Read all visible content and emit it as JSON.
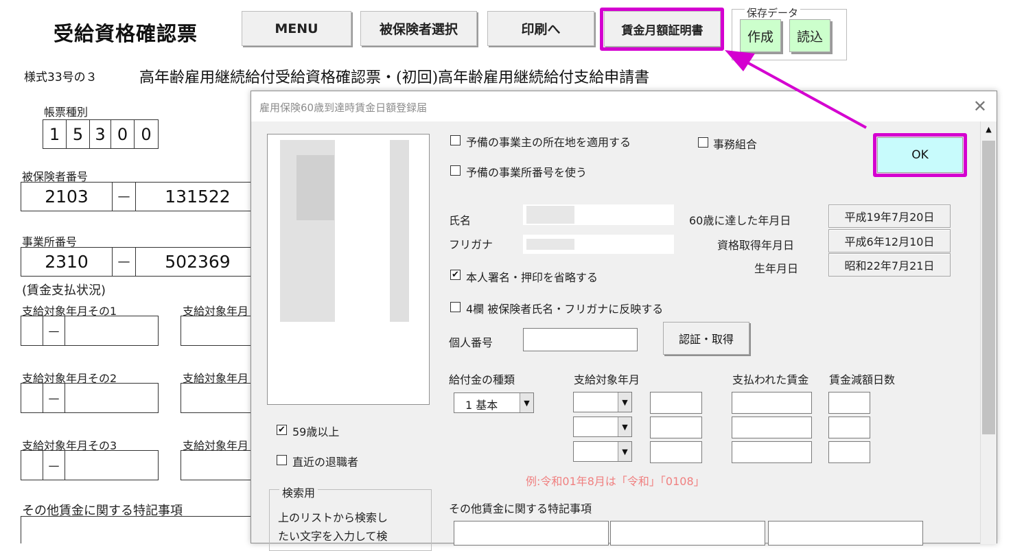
{
  "sheet": {
    "title": "受給資格確認票",
    "buttons": {
      "menu": "MENU",
      "insured_select": "被保険者選択",
      "to_print": "印刷へ",
      "wage_certificate": "賃金月額証明書"
    },
    "save_data": {
      "legend": "保存データ",
      "create": "作成",
      "load": "読込"
    },
    "form_number": "様式33号の３",
    "form_title": "高年齢雇用継続給付受給資格確認票・(初回)高年齢雇用継続給付支給申請書",
    "form_type": {
      "label": "帳票種別",
      "digits": [
        "1",
        "5",
        "3",
        "0",
        "0"
      ]
    },
    "insured_number": {
      "label": "被保険者番号",
      "part1": "2103",
      "dash": "—",
      "part2": "131522"
    },
    "office_number": {
      "label": "事業所番号",
      "part1": "2310",
      "dash": "—",
      "part2": "502369"
    },
    "wage_status_label": "(賃金支払状況)",
    "period1": "支給対象年月その1",
    "period2": "支給対象年月その2",
    "period3": "支給対象年月その3",
    "period_right": "支給対象年月",
    "dash": "—",
    "special_notes": "その他賃金に関する特記事項"
  },
  "dialog": {
    "title": "雇用保険60歳到達時賃金日額登録届",
    "close": "✕",
    "ok": "OK",
    "opt_spare_address": "予備の事業主の所在地を適用する",
    "opt_spare_office": "予備の事業所番号を使う",
    "opt_union": "事務組合",
    "name_label": "氏名",
    "furigana_label": "フリガナ",
    "age60_label": "60歳に達した年月日",
    "age60_value": "平成19年7月20日",
    "acquired_label": "資格取得年月日",
    "acquired_value": "平成6年12月10日",
    "birth_label": "生年月日",
    "birth_value": "昭和22年7月21日",
    "opt_omit_seal": "本人署名・押印を省略する",
    "opt_reflect_name": "4欄 被保険者氏名・フリガナに反映する",
    "personal_no_label": "個人番号",
    "auth_button": "認証・取得",
    "benefit_type_label": "給付金の種類",
    "benefit_type_value": "1 基本",
    "period_label": "支給対象年月",
    "paid_wage_label": "支払われた賃金",
    "deduct_days_label": "賃金減額日数",
    "hint": "例:令和01年8月は「令和」「0108」",
    "notes_label": "その他賃金に関する特記事項",
    "opt_over59": "59歳以上",
    "opt_recent_retiree": "直近の退職者",
    "search_legend": "検索用",
    "search_help": [
      "上のリストから検索し",
      "たい文字を入力して検"
    ],
    "check_mark": "✔",
    "dropdown_arrow": "▼",
    "scroll_up": "▲"
  },
  "colors": {
    "highlight": "#d400d0",
    "ok_bg": "#c8fbfc",
    "save_btn_bg": "#ccffcc",
    "hint": "#f08080"
  }
}
